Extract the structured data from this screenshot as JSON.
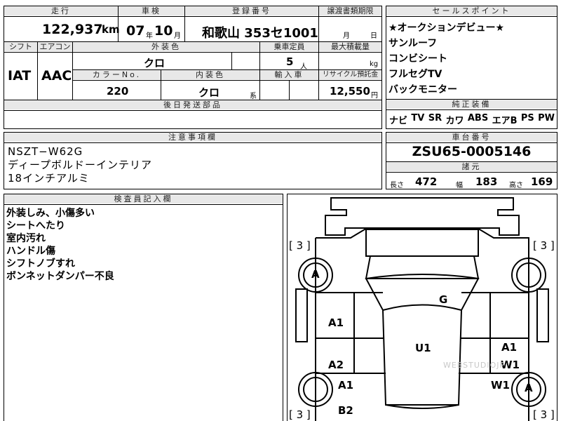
{
  "top": {
    "headers": {
      "mileage": "走行",
      "inspection": "車検",
      "registration": "登録番号",
      "transfer_date": "譲渡書類期限",
      "shift": "シフト",
      "aircon": "エアコン",
      "exterior_color": "外装色",
      "capacity": "乗車定員",
      "max_load": "最大積載量",
      "color_no": "カラーNo.",
      "interior_color": "内装色",
      "import": "輸入車",
      "recycle": "リサイクル預託金",
      "later_parts": "後日発送部品"
    },
    "values": {
      "mileage": "122,937",
      "mileage_unit": "km",
      "inspection_year": "07",
      "inspection_year_unit": "年",
      "inspection_month": "10",
      "inspection_month_unit": "月",
      "registration": "和歌山 353セ1001",
      "transfer_month_unit": "月",
      "transfer_day_unit": "日",
      "shift": "IAT",
      "aircon": "AAC",
      "exterior_color": "クロ",
      "capacity": "5",
      "capacity_unit": "人",
      "max_load_unit": "kg",
      "color_no": "220",
      "interior_color": "クロ",
      "interior_suffix": "系",
      "recycle": "12,550",
      "recycle_unit": "円"
    }
  },
  "sales_points": {
    "header": "セールスポイント",
    "items": [
      "★オークションデビュー★",
      "サンルーフ",
      "コンビシート",
      "フルセグTV",
      "バックモニター"
    ]
  },
  "equipment": {
    "header": "純正装備",
    "items": [
      "ナビ",
      "TV",
      "SR",
      "カワ",
      "ABS",
      "エアB",
      "PS",
      "PW"
    ]
  },
  "notes": {
    "header": "注意事項欄",
    "lines": [
      "NSZT−W62G",
      "ディープボルドーインテリア",
      "18インチアルミ"
    ]
  },
  "chassis": {
    "header": "車台番号",
    "value": "ZSU65-0005146"
  },
  "dimensions": {
    "header": "諸元",
    "length_label": "長さ",
    "length": "472",
    "width_label": "幅",
    "width": "183",
    "height_label": "高さ",
    "height": "169"
  },
  "inspector": {
    "header": "検査員記入欄",
    "lines": [
      "外装しみ、小傷多い",
      "シートへたり",
      "室内汚れ",
      "ハンドル傷",
      "シフトノブすれ",
      "ボンネットダンパー不良"
    ]
  },
  "diagram": {
    "tire_left_front": "[ 3 ]",
    "tire_right_front": "[ 3 ]",
    "tire_left_rear": "[ 3 ]",
    "tire_right_rear": "[ 3 ]",
    "marks": {
      "wheel_front_left": "A",
      "wheel_rear_right": "A",
      "windshield": "G",
      "left_front_door": "A1",
      "left_rear_door": "A2",
      "left_rear_quarter": "A1",
      "left_rear_lower": "B2",
      "roof": "U1",
      "right_rear_door_a": "A1",
      "right_rear_door_w": "W1",
      "right_rear_quarter": "W1"
    },
    "watermark": "WEBSTUDIOJP"
  }
}
